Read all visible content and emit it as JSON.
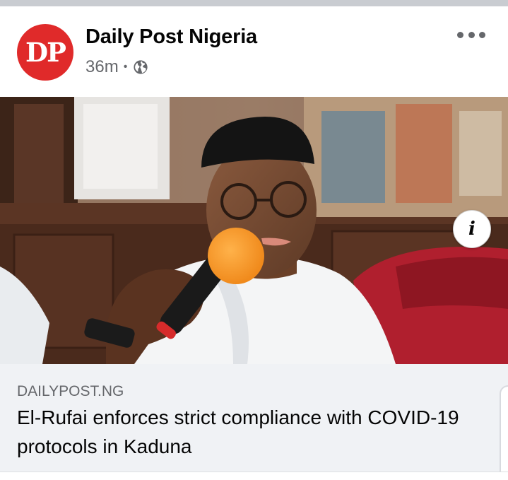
{
  "post": {
    "page_name": "Daily Post Nigeria",
    "avatar_text": "DP",
    "timestamp": "36m",
    "separator": "•",
    "privacy_icon": "globe-icon",
    "menu_icon": "more-options-icon"
  },
  "photo": {
    "info_glyph": "i"
  },
  "link": {
    "domain": "DAILYPOST.NG",
    "title": "El-Rufai enforces strict compliance with COVID-19 protocols in Kaduna"
  },
  "colors": {
    "brand_red": "#e02a2a",
    "secondary_text": "#65676b",
    "card_bg": "#f0f2f5"
  }
}
